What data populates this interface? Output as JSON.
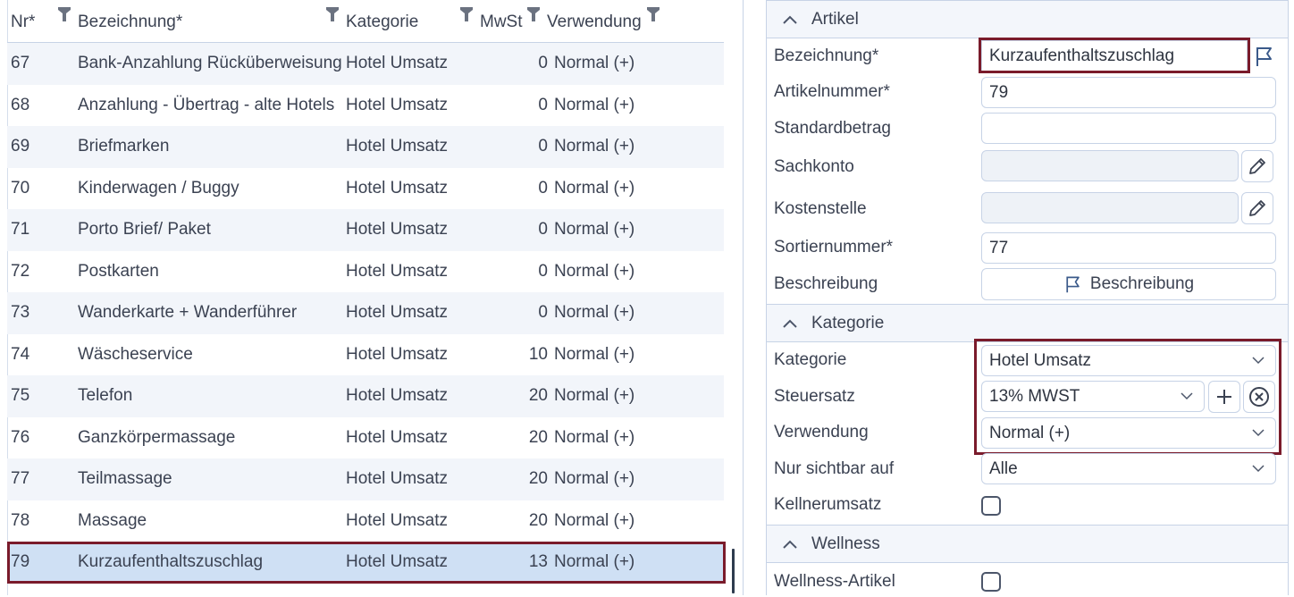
{
  "grid": {
    "columns": {
      "nr": "Nr*",
      "bezeichnung": "Bezeichnung*",
      "kategorie": "Kategorie",
      "mwst": "MwSt",
      "verwendung": "Verwendung"
    },
    "rows": [
      {
        "nr": "67",
        "bezeichnung": "Bank-Anzahlung Rücküberweisung",
        "kategorie": "Hotel Umsatz",
        "mwst": "0",
        "verwendung": "Normal (+)"
      },
      {
        "nr": "68",
        "bezeichnung": "Anzahlung - Übertrag - alte Hotels",
        "kategorie": "Hotel Umsatz",
        "mwst": "0",
        "verwendung": "Normal (+)"
      },
      {
        "nr": "69",
        "bezeichnung": "Briefmarken",
        "kategorie": "Hotel Umsatz",
        "mwst": "0",
        "verwendung": "Normal (+)"
      },
      {
        "nr": "70",
        "bezeichnung": "Kinderwagen / Buggy",
        "kategorie": "Hotel Umsatz",
        "mwst": "0",
        "verwendung": "Normal (+)"
      },
      {
        "nr": "71",
        "bezeichnung": "Porto Brief/ Paket",
        "kategorie": "Hotel Umsatz",
        "mwst": "0",
        "verwendung": "Normal (+)"
      },
      {
        "nr": "72",
        "bezeichnung": "Postkarten",
        "kategorie": "Hotel Umsatz",
        "mwst": "0",
        "verwendung": "Normal (+)"
      },
      {
        "nr": "73",
        "bezeichnung": "Wanderkarte + Wanderführer",
        "kategorie": "Hotel Umsatz",
        "mwst": "0",
        "verwendung": "Normal (+)"
      },
      {
        "nr": "74",
        "bezeichnung": "Wäscheservice",
        "kategorie": "Hotel Umsatz",
        "mwst": "10",
        "verwendung": "Normal (+)"
      },
      {
        "nr": "75",
        "bezeichnung": "Telefon",
        "kategorie": "Hotel Umsatz",
        "mwst": "20",
        "verwendung": "Normal (+)"
      },
      {
        "nr": "76",
        "bezeichnung": "Ganzkörpermassage",
        "kategorie": "Hotel Umsatz",
        "mwst": "20",
        "verwendung": "Normal (+)"
      },
      {
        "nr": "77",
        "bezeichnung": "Teilmassage",
        "kategorie": "Hotel Umsatz",
        "mwst": "20",
        "verwendung": "Normal (+)"
      },
      {
        "nr": "78",
        "bezeichnung": "Massage",
        "kategorie": "Hotel Umsatz",
        "mwst": "20",
        "verwendung": "Normal (+)"
      },
      {
        "nr": "79",
        "bezeichnung": "Kurzaufenthaltszuschlag",
        "kategorie": "Hotel Umsatz",
        "mwst": "13",
        "verwendung": "Normal (+)",
        "selected": true
      }
    ]
  },
  "panel": {
    "artikel": {
      "title": "Artikel",
      "bezeichnung_label": "Bezeichnung*",
      "bezeichnung_value": "Kurzaufenthaltszuschlag",
      "artikelnummer_label": "Artikelnummer*",
      "artikelnummer_value": "79",
      "standardbetrag_label": "Standardbetrag",
      "standardbetrag_value": "",
      "sachkonto_label": "Sachkonto",
      "kostenstelle_label": "Kostenstelle",
      "sortiernummer_label": "Sortiernummer*",
      "sortiernummer_value": "77",
      "beschreibung_label": "Beschreibung",
      "beschreibung_button": "Beschreibung"
    },
    "kategorie": {
      "title": "Kategorie",
      "kategorie_label": "Kategorie",
      "kategorie_value": "Hotel Umsatz",
      "steuersatz_label": "Steuersatz",
      "steuersatz_value": "13% MWST",
      "verwendung_label": "Verwendung",
      "verwendung_value": "Normal (+)",
      "sichtbar_label": "Nur sichtbar auf",
      "sichtbar_value": "Alle",
      "kellner_label": "Kellnerumsatz"
    },
    "wellness": {
      "title": "Wellness",
      "artikel_label": "Wellness-Artikel"
    }
  },
  "colors": {
    "highlight": "#7a1b2b",
    "selected_row": "#cfe0f4",
    "alt_row": "#f2f5fa",
    "border": "#c7d3e6"
  },
  "icons": [
    "filter-icon",
    "flag-icon",
    "pencil-icon",
    "plus-icon",
    "clear-circle-icon",
    "chevron-up-icon",
    "chevron-down-icon"
  ]
}
